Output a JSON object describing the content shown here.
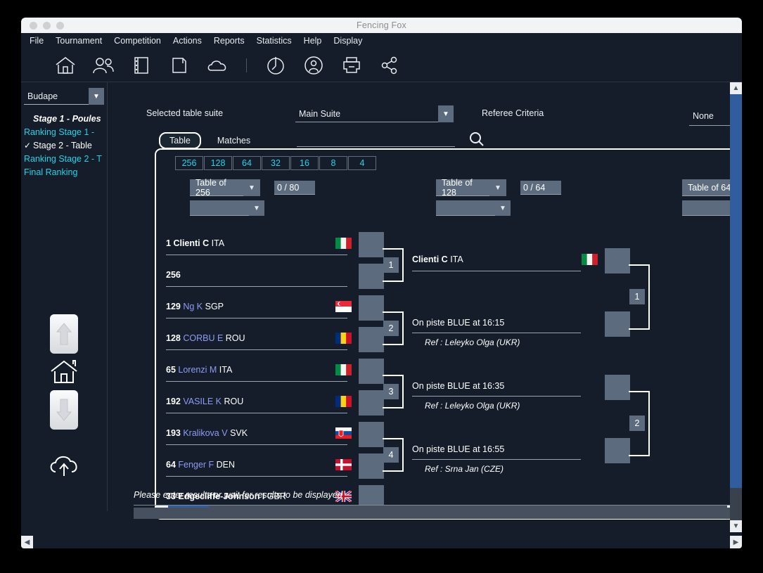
{
  "window": {
    "title": "Fencing Fox"
  },
  "menu": {
    "items": [
      "File",
      "Tournament",
      "Competition",
      "Actions",
      "Reports",
      "Statistics",
      "Help",
      "Display"
    ]
  },
  "toolbar": {
    "icons": [
      "home-icon",
      "people-icon",
      "list-icon",
      "save-icon",
      "cloud-icon",
      "timer-icon",
      "referee-icon",
      "print-icon",
      "share-icon"
    ]
  },
  "sidebar": {
    "competition_value": "Budape",
    "stages": [
      {
        "label": "Stage 1 - Poules",
        "style": "it",
        "checked": false
      },
      {
        "label": "Ranking Stage 1 - ",
        "style": "cy",
        "checked": false
      },
      {
        "label": "Stage 2 - Table",
        "style": "sel",
        "checked": true
      },
      {
        "label": "Ranking Stage 2 - T",
        "style": "cy",
        "checked": false
      },
      {
        "label": "Final Ranking",
        "style": "cy",
        "checked": false
      }
    ],
    "nav": {
      "up": "up-arrow-button",
      "home": "home-button",
      "down": "down-arrow-button",
      "upload": "cloud-upload-button"
    },
    "strips": [
      "#3300ff",
      "#f7f719",
      "#2ee81e",
      "#f01520"
    ]
  },
  "header": {
    "selected_table_suite_label": "Selected table suite",
    "suite_value": "Main Suite",
    "referee_criteria_label": "Referee Criteria",
    "referee_criteria_value": "None",
    "search_value": "",
    "search_placeholder": ""
  },
  "tabs": [
    {
      "label": "Table",
      "active": true
    },
    {
      "label": "Matches",
      "active": false
    }
  ],
  "table_sizes": [
    "256",
    "128",
    "64",
    "32",
    "16",
    "8",
    "4"
  ],
  "columns": [
    {
      "table_label": "Table of 256",
      "counter": "0 / 80",
      "sub_value": ""
    },
    {
      "table_label": "Table of 128",
      "counter": "0 / 64",
      "sub_value": ""
    },
    {
      "table_label": "Table of 64",
      "counter": "",
      "sub_value": ""
    }
  ],
  "bracket": {
    "round1": [
      {
        "seed": "1",
        "name": "Clienti C",
        "nat": "ITA",
        "name_style": "bold",
        "flag": "ITA"
      },
      {
        "seed": "",
        "name": "256",
        "nat": "",
        "name_style": "seed-only",
        "flag": ""
      },
      {
        "seed": "129",
        "name": "Ng K",
        "nat": "SGP",
        "name_style": "blue",
        "flag": "SGP"
      },
      {
        "seed": "128",
        "name": "CORBU E",
        "nat": "ROU",
        "name_style": "blue",
        "flag": "ROU"
      },
      {
        "seed": "65",
        "name": "Lorenzi M",
        "nat": "ITA",
        "name_style": "blue",
        "flag": "ITA"
      },
      {
        "seed": "192",
        "name": "VASILE K",
        "nat": "ROU",
        "name_style": "blue",
        "flag": "ROU"
      },
      {
        "seed": "193",
        "name": "Kralikova V",
        "nat": "SVK",
        "name_style": "blue",
        "flag": "SVK"
      },
      {
        "seed": "64",
        "name": "Fenger F",
        "nat": "DEN",
        "name_style": "blue",
        "flag": "DEN"
      },
      {
        "seed": "33",
        "name": "Edgecliffe-Johnson I",
        "nat": "GBR",
        "name_style": "bold",
        "flag": "GBR"
      }
    ],
    "round1_match_numbers": [
      "1",
      "2",
      "3",
      "4"
    ],
    "round2": [
      {
        "kind": "player",
        "name": "Clienti C",
        "nat": "ITA",
        "flag": "ITA"
      },
      {
        "kind": "info",
        "text": "On piste BLUE at 16:15",
        "ref": "Ref : Leleyko Olga (UKR)"
      },
      {
        "kind": "info",
        "text": "On piste BLUE at 16:35",
        "ref": "Ref : Leleyko Olga (UKR)"
      },
      {
        "kind": "info",
        "text": "On piste BLUE at 16:55",
        "ref": "Ref : Srna Jan (CZE)"
      }
    ],
    "round2_match_numbers": [
      "1",
      "2"
    ]
  },
  "status": {
    "message": "Please enter results or wait for results to be displayed"
  }
}
